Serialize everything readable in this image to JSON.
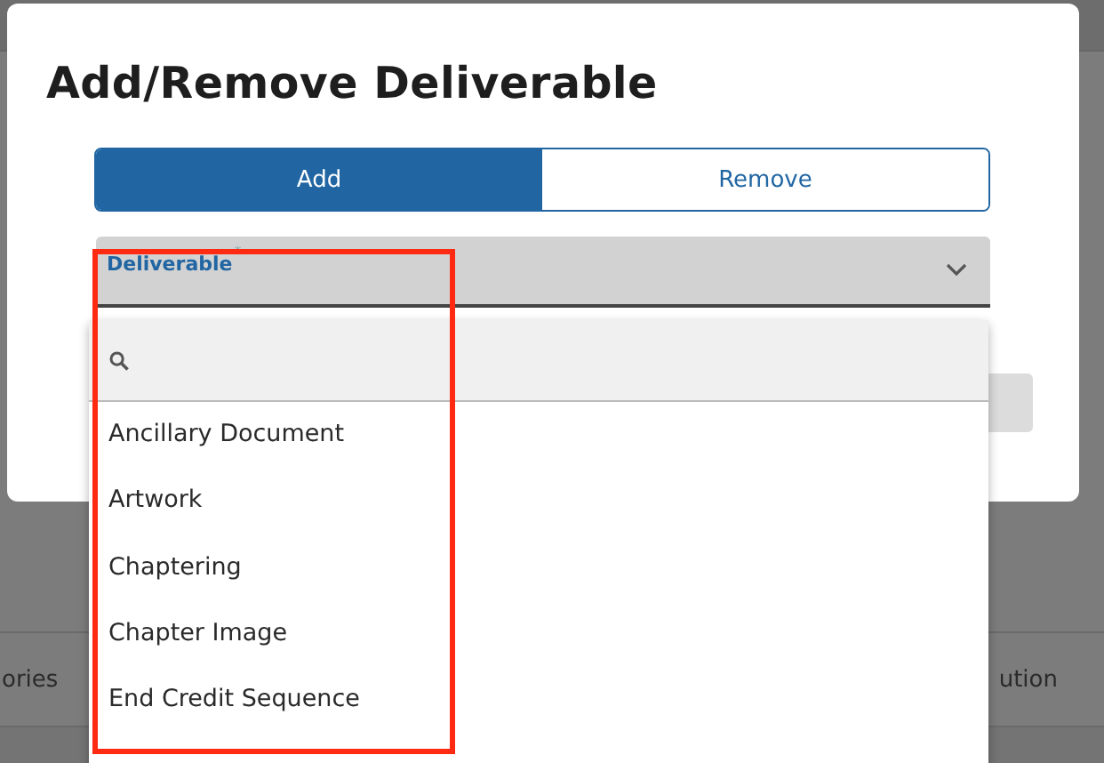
{
  "background_table": {
    "columns": [
      "ories",
      "ution"
    ]
  },
  "dialog": {
    "title": "Add/Remove Deliverable",
    "tabs": [
      {
        "label": "Add",
        "selected": true
      },
      {
        "label": "Remove",
        "selected": false
      }
    ],
    "select": {
      "label": "Deliverable",
      "required_mark": "*",
      "expanded": true,
      "options": [
        {
          "label": "Ancillary Document"
        },
        {
          "label": "Artwork"
        },
        {
          "label": "Chaptering"
        },
        {
          "label": "Chapter Image"
        },
        {
          "label": "End Credit Sequence"
        }
      ]
    }
  }
}
